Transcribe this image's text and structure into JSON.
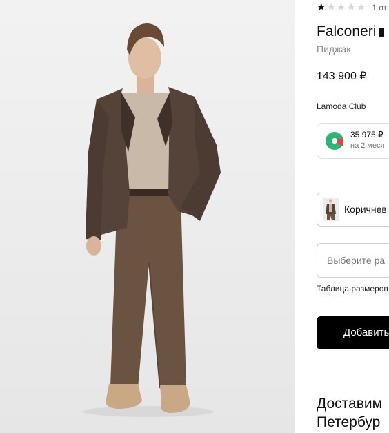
{
  "rating": {
    "stars_filled": 1,
    "stars_total": 5,
    "summary": "1 от"
  },
  "product": {
    "brand": "Falconeri",
    "category": "Пиджак",
    "price": "143 900 ₽",
    "image_alt": "photo-model-brown-blazer"
  },
  "club": {
    "label": "Lamoda Club"
  },
  "split": {
    "amount": "35 975 ₽",
    "term": "на 2 меся",
    "icon": "split-pay-icon",
    "colors": {
      "green": "#2bb673",
      "red": "#ee3d48"
    }
  },
  "color_select": {
    "value": "Коричнев"
  },
  "size_select": {
    "placeholder": "Выберите ра",
    "size_table_link": "Таблица размеров"
  },
  "cart": {
    "add_label": "Добавить"
  },
  "delivery": {
    "line1": "Доставим",
    "line2": "Петербур"
  },
  "colors": {
    "accent": "#000000",
    "muted_text": "#8a8a8a",
    "border": "#cfcfcf"
  }
}
